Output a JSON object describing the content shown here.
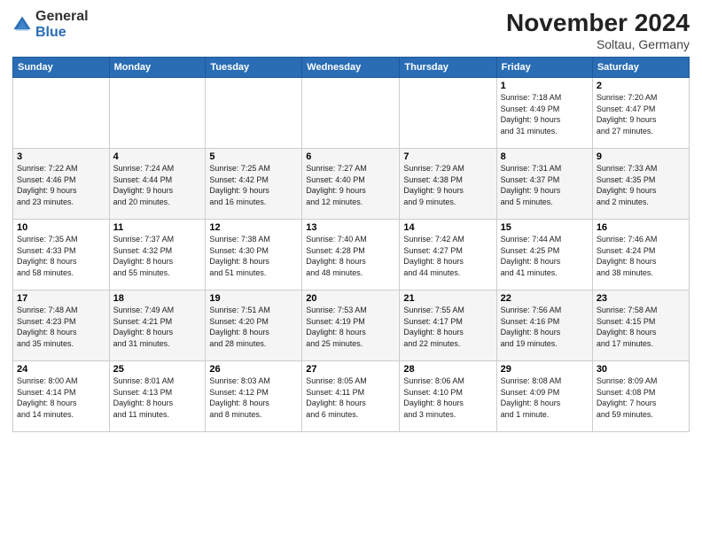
{
  "logo": {
    "general": "General",
    "blue": "Blue"
  },
  "header": {
    "month": "November 2024",
    "location": "Soltau, Germany"
  },
  "weekdays": [
    "Sunday",
    "Monday",
    "Tuesday",
    "Wednesday",
    "Thursday",
    "Friday",
    "Saturday"
  ],
  "weeks": [
    [
      {
        "day": "",
        "info": ""
      },
      {
        "day": "",
        "info": ""
      },
      {
        "day": "",
        "info": ""
      },
      {
        "day": "",
        "info": ""
      },
      {
        "day": "",
        "info": ""
      },
      {
        "day": "1",
        "info": "Sunrise: 7:18 AM\nSunset: 4:49 PM\nDaylight: 9 hours\nand 31 minutes."
      },
      {
        "day": "2",
        "info": "Sunrise: 7:20 AM\nSunset: 4:47 PM\nDaylight: 9 hours\nand 27 minutes."
      }
    ],
    [
      {
        "day": "3",
        "info": "Sunrise: 7:22 AM\nSunset: 4:46 PM\nDaylight: 9 hours\nand 23 minutes."
      },
      {
        "day": "4",
        "info": "Sunrise: 7:24 AM\nSunset: 4:44 PM\nDaylight: 9 hours\nand 20 minutes."
      },
      {
        "day": "5",
        "info": "Sunrise: 7:25 AM\nSunset: 4:42 PM\nDaylight: 9 hours\nand 16 minutes."
      },
      {
        "day": "6",
        "info": "Sunrise: 7:27 AM\nSunset: 4:40 PM\nDaylight: 9 hours\nand 12 minutes."
      },
      {
        "day": "7",
        "info": "Sunrise: 7:29 AM\nSunset: 4:38 PM\nDaylight: 9 hours\nand 9 minutes."
      },
      {
        "day": "8",
        "info": "Sunrise: 7:31 AM\nSunset: 4:37 PM\nDaylight: 9 hours\nand 5 minutes."
      },
      {
        "day": "9",
        "info": "Sunrise: 7:33 AM\nSunset: 4:35 PM\nDaylight: 9 hours\nand 2 minutes."
      }
    ],
    [
      {
        "day": "10",
        "info": "Sunrise: 7:35 AM\nSunset: 4:33 PM\nDaylight: 8 hours\nand 58 minutes."
      },
      {
        "day": "11",
        "info": "Sunrise: 7:37 AM\nSunset: 4:32 PM\nDaylight: 8 hours\nand 55 minutes."
      },
      {
        "day": "12",
        "info": "Sunrise: 7:38 AM\nSunset: 4:30 PM\nDaylight: 8 hours\nand 51 minutes."
      },
      {
        "day": "13",
        "info": "Sunrise: 7:40 AM\nSunset: 4:28 PM\nDaylight: 8 hours\nand 48 minutes."
      },
      {
        "day": "14",
        "info": "Sunrise: 7:42 AM\nSunset: 4:27 PM\nDaylight: 8 hours\nand 44 minutes."
      },
      {
        "day": "15",
        "info": "Sunrise: 7:44 AM\nSunset: 4:25 PM\nDaylight: 8 hours\nand 41 minutes."
      },
      {
        "day": "16",
        "info": "Sunrise: 7:46 AM\nSunset: 4:24 PM\nDaylight: 8 hours\nand 38 minutes."
      }
    ],
    [
      {
        "day": "17",
        "info": "Sunrise: 7:48 AM\nSunset: 4:23 PM\nDaylight: 8 hours\nand 35 minutes."
      },
      {
        "day": "18",
        "info": "Sunrise: 7:49 AM\nSunset: 4:21 PM\nDaylight: 8 hours\nand 31 minutes."
      },
      {
        "day": "19",
        "info": "Sunrise: 7:51 AM\nSunset: 4:20 PM\nDaylight: 8 hours\nand 28 minutes."
      },
      {
        "day": "20",
        "info": "Sunrise: 7:53 AM\nSunset: 4:19 PM\nDaylight: 8 hours\nand 25 minutes."
      },
      {
        "day": "21",
        "info": "Sunrise: 7:55 AM\nSunset: 4:17 PM\nDaylight: 8 hours\nand 22 minutes."
      },
      {
        "day": "22",
        "info": "Sunrise: 7:56 AM\nSunset: 4:16 PM\nDaylight: 8 hours\nand 19 minutes."
      },
      {
        "day": "23",
        "info": "Sunrise: 7:58 AM\nSunset: 4:15 PM\nDaylight: 8 hours\nand 17 minutes."
      }
    ],
    [
      {
        "day": "24",
        "info": "Sunrise: 8:00 AM\nSunset: 4:14 PM\nDaylight: 8 hours\nand 14 minutes."
      },
      {
        "day": "25",
        "info": "Sunrise: 8:01 AM\nSunset: 4:13 PM\nDaylight: 8 hours\nand 11 minutes."
      },
      {
        "day": "26",
        "info": "Sunrise: 8:03 AM\nSunset: 4:12 PM\nDaylight: 8 hours\nand 8 minutes."
      },
      {
        "day": "27",
        "info": "Sunrise: 8:05 AM\nSunset: 4:11 PM\nDaylight: 8 hours\nand 6 minutes."
      },
      {
        "day": "28",
        "info": "Sunrise: 8:06 AM\nSunset: 4:10 PM\nDaylight: 8 hours\nand 3 minutes."
      },
      {
        "day": "29",
        "info": "Sunrise: 8:08 AM\nSunset: 4:09 PM\nDaylight: 8 hours\nand 1 minute."
      },
      {
        "day": "30",
        "info": "Sunrise: 8:09 AM\nSunset: 4:08 PM\nDaylight: 7 hours\nand 59 minutes."
      }
    ]
  ]
}
